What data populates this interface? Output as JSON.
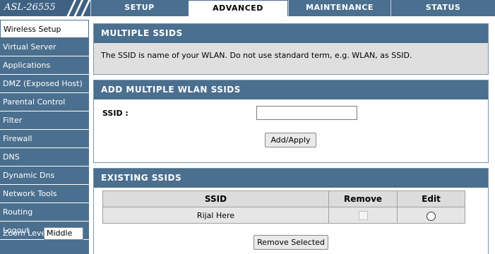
{
  "brand": "ASL-26555",
  "tabs": [
    "SETUP",
    "ADVANCED",
    "MAINTENANCE",
    "STATUS"
  ],
  "active_tab": "ADVANCED",
  "sidebar": {
    "items": [
      "Wireless Setup",
      "Virtual Server",
      "Applications",
      "DMZ (Exposed Host)",
      "Parental Control",
      "Filter",
      "Firewall",
      "DNS",
      "Dynamic Dns",
      "Network Tools",
      "Routing",
      "Logout"
    ],
    "active": "Wireless Setup",
    "zoom_label": "Zoom Level",
    "zoom_value": "Middle"
  },
  "multiple": {
    "title": "MULTIPLE SSIDS",
    "description": "The SSID is name of your WLAN. Do not use standard term, e.g. WLAN, as SSID."
  },
  "add": {
    "title": "ADD MULTIPLE WLAN SSIDS",
    "ssid_label": "SSID :",
    "ssid_value": "",
    "button": "Add/Apply"
  },
  "existing": {
    "title": "EXISTING SSIDS",
    "columns": [
      "SSID",
      "Remove",
      "Edit"
    ],
    "rows": [
      {
        "ssid": "Rijal Here",
        "remove": false,
        "edit": false
      }
    ],
    "remove_button": "Remove Selected"
  },
  "colors": {
    "header_blue": "#4a6f8f",
    "panel_grey": "#dfdfdf"
  }
}
